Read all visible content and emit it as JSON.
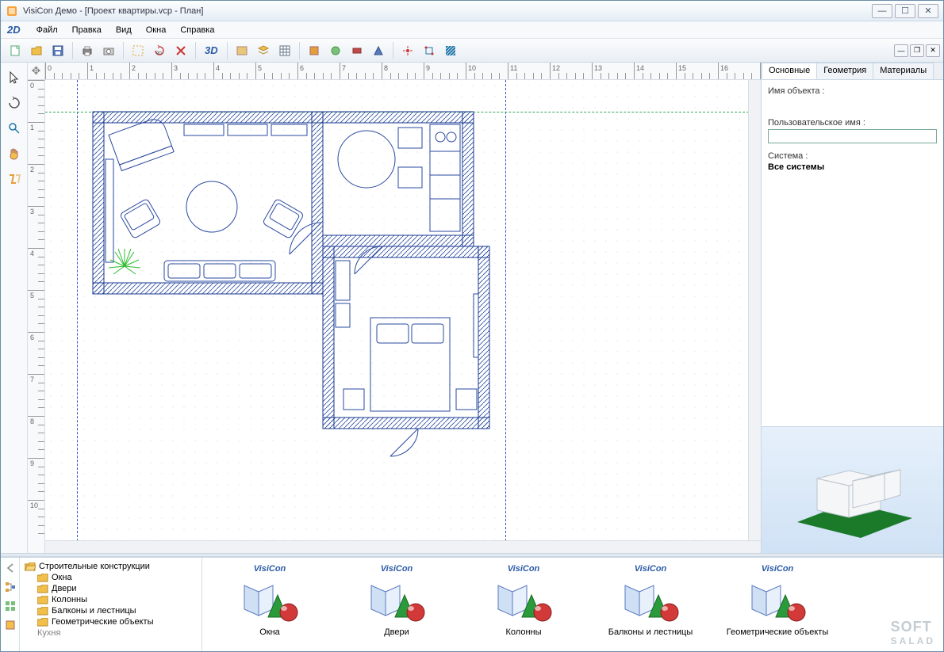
{
  "window": {
    "title": "VisiCon Демо - [Проект квартиры.vcp - План]"
  },
  "menubar": {
    "mode2d": "2D",
    "items": [
      "Файл",
      "Правка",
      "Вид",
      "Окна",
      "Справка"
    ]
  },
  "toolbar": {
    "mode3d_label": "3D",
    "buttons": [
      {
        "name": "new-file-icon"
      },
      {
        "name": "open-file-icon"
      },
      {
        "name": "save-icon"
      },
      {
        "sep": true
      },
      {
        "name": "print-icon"
      },
      {
        "name": "camera-icon"
      },
      {
        "sep": true
      },
      {
        "name": "select-marquee-icon"
      },
      {
        "name": "rotate-90-icon"
      },
      {
        "name": "delete-icon"
      },
      {
        "sep": true
      },
      {
        "name": "mode-3d-icon",
        "label": "3D"
      },
      {
        "sep": true
      },
      {
        "name": "layer-icon"
      },
      {
        "name": "layers-icon"
      },
      {
        "name": "grid-icon"
      },
      {
        "sep": true
      },
      {
        "name": "tool-a-icon"
      },
      {
        "name": "tool-b-icon"
      },
      {
        "name": "tool-c-icon"
      },
      {
        "name": "tool-d-icon"
      },
      {
        "sep": true
      },
      {
        "name": "snap-a-icon"
      },
      {
        "name": "snap-b-icon"
      },
      {
        "name": "hatch-icon"
      }
    ]
  },
  "left_tools": [
    {
      "name": "cursor-tool"
    },
    {
      "name": "rotate-tool"
    },
    {
      "name": "zoom-tool"
    },
    {
      "name": "pan-hand-tool"
    },
    {
      "name": "orbit-tool"
    }
  ],
  "ruler": {
    "units_max_h": 17,
    "units_max_v": 10
  },
  "side_panel": {
    "tabs": [
      "Основные",
      "Геометрия",
      "Материалы"
    ],
    "active_tab": 0,
    "object_name_label": "Имя объекта :",
    "object_name_value": "",
    "user_name_label": "Пользовательское имя :",
    "user_name_value": "",
    "system_label": "Система :",
    "system_value": "Все системы"
  },
  "catalog": {
    "root_label": "Строительные конструкции",
    "folders": [
      "Окна",
      "Двери",
      "Колонны",
      "Балконы и лестницы",
      "Геометрические объекты"
    ],
    "cutoff": "Кухня",
    "brand": "VisiCon",
    "items": [
      "Окна",
      "Двери",
      "Колонны",
      "Балконы и лестницы",
      "Геометрические объекты"
    ]
  },
  "watermark": {
    "line1": "SOFT",
    "line2": "SALAD"
  }
}
